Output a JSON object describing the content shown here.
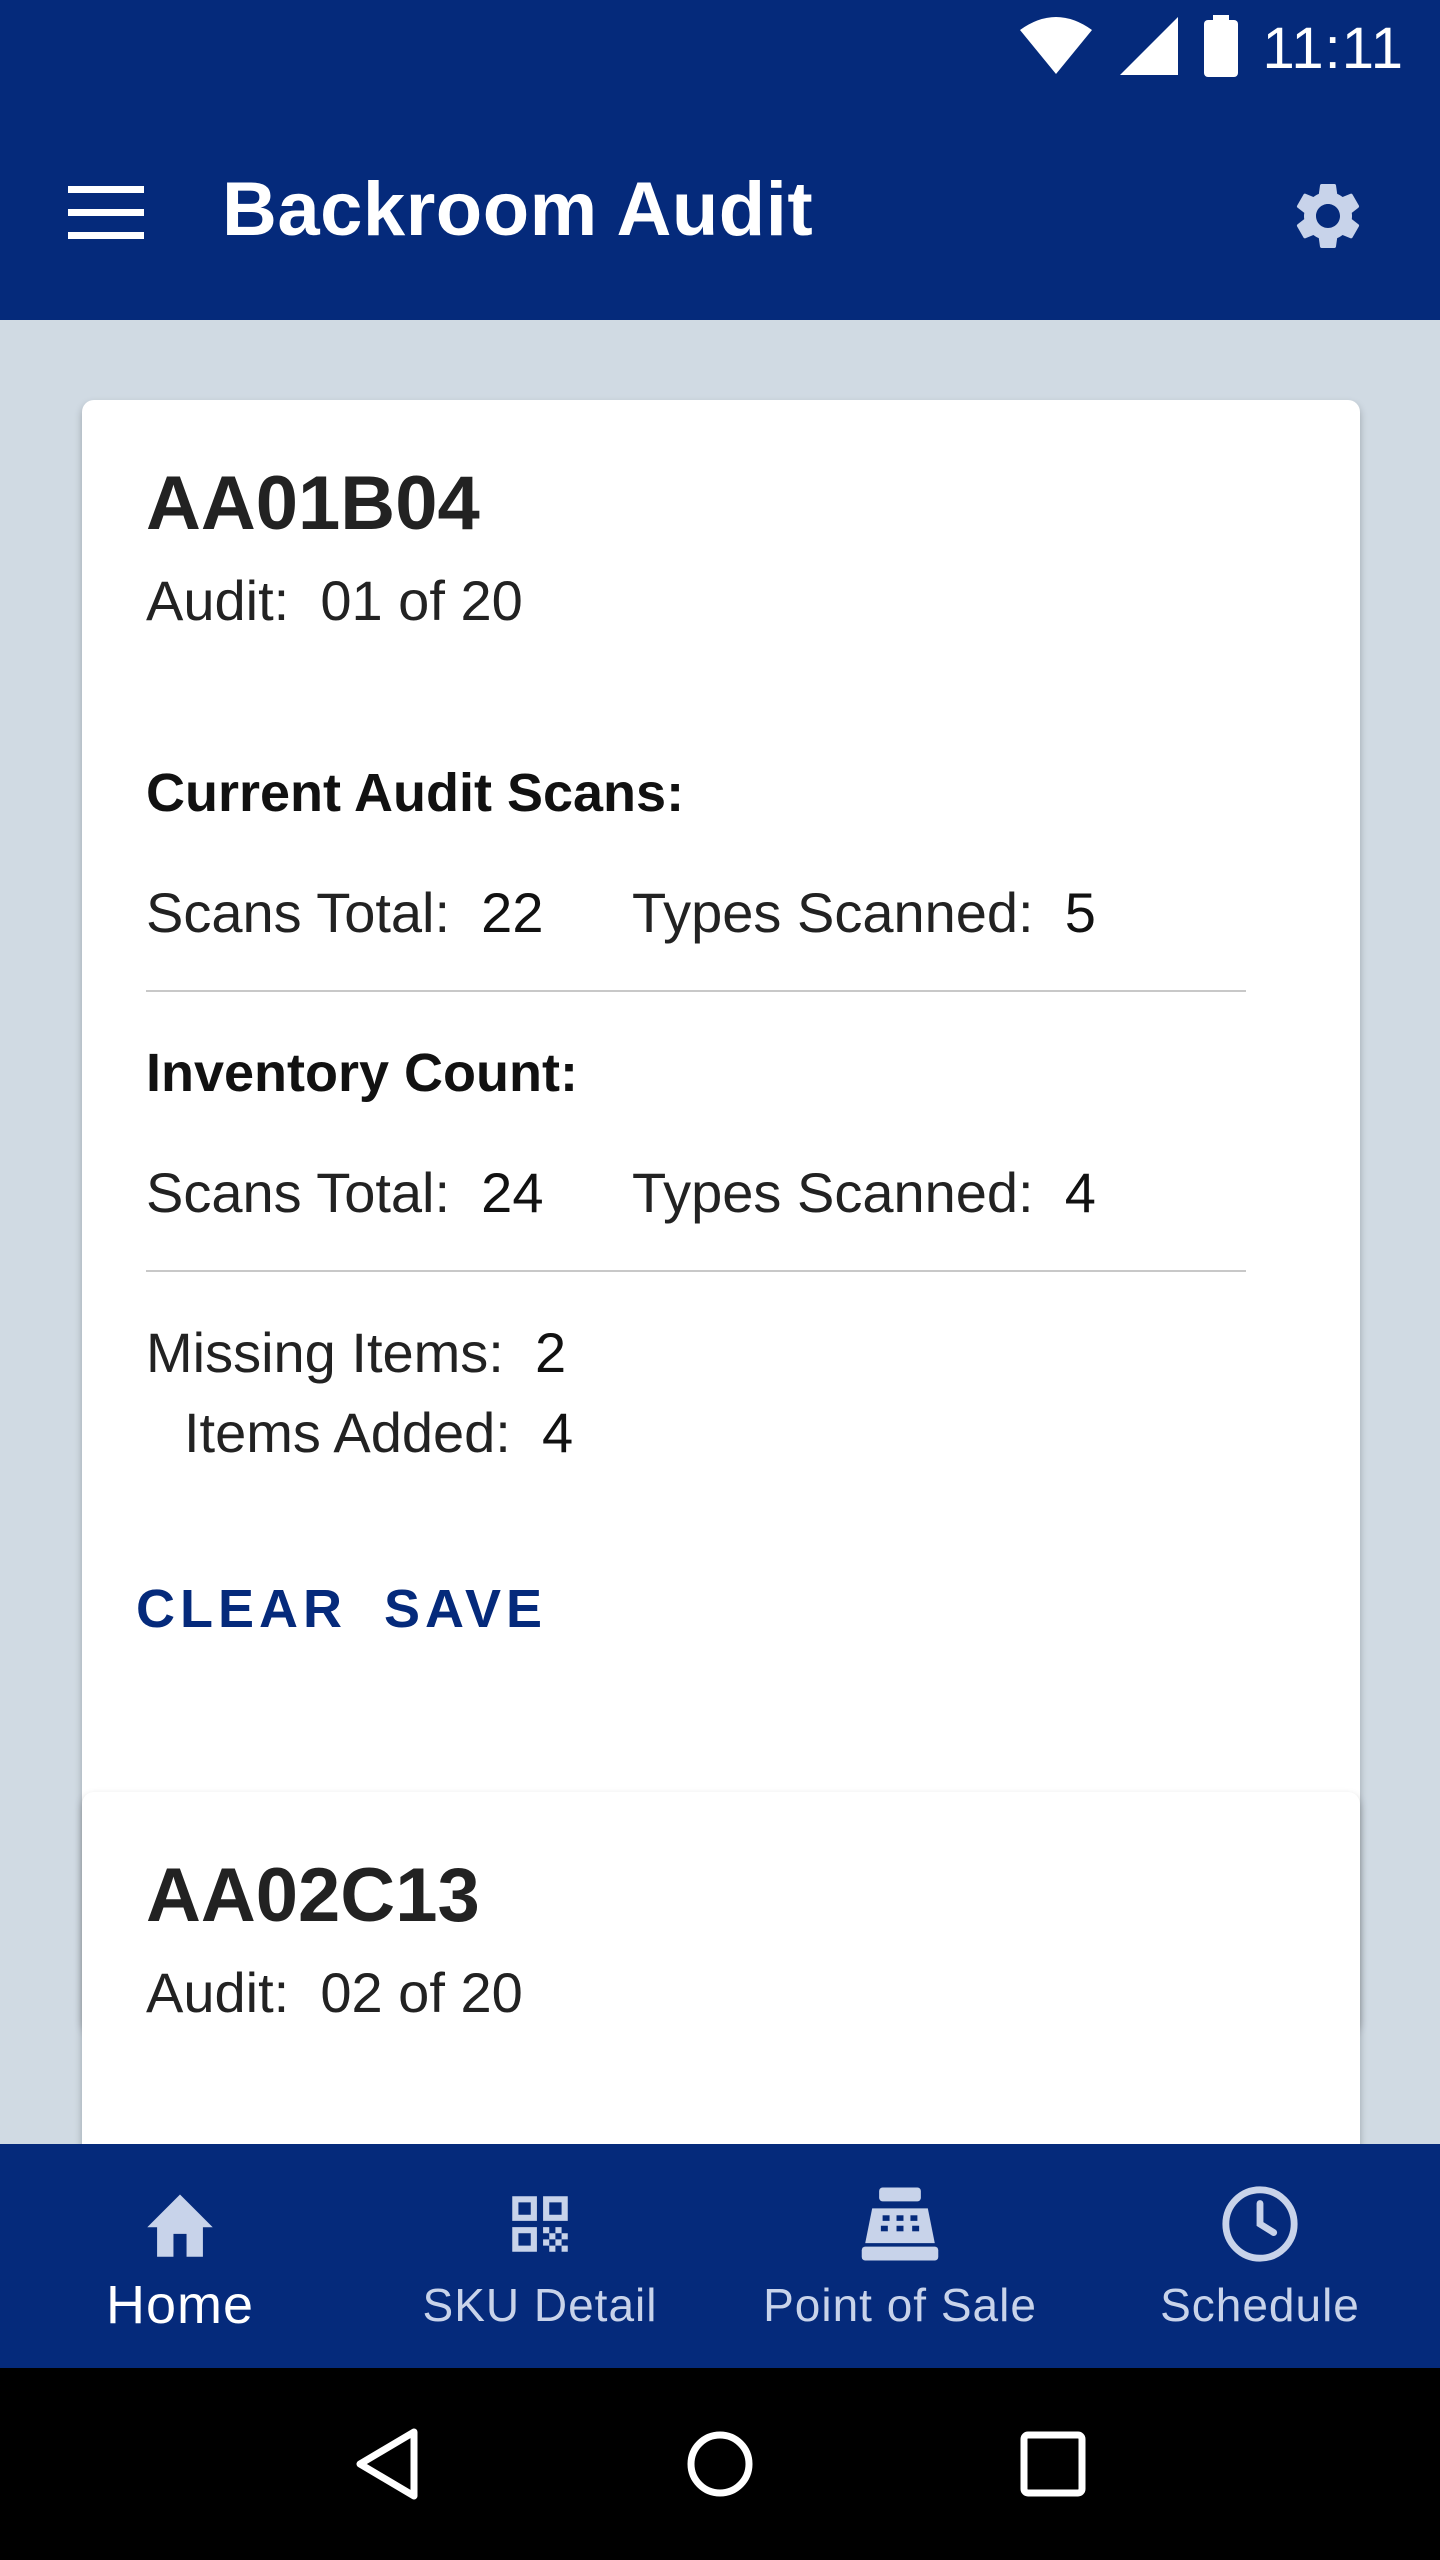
{
  "status_bar": {
    "time": "11:11",
    "icons": [
      "wifi-icon",
      "signal-icon",
      "battery-icon"
    ]
  },
  "app_bar": {
    "title": "Backroom Audit",
    "menu_icon": "hamburger-menu-icon",
    "settings_icon": "gear-icon"
  },
  "cards": [
    {
      "id": "AA01B04",
      "audit_label": "Audit:",
      "audit_value": "01 of 20",
      "current_scans": {
        "title": "Current Audit Scans:",
        "scans_total_label": "Scans Total:",
        "scans_total_value": "22",
        "types_scanned_label": "Types Scanned:",
        "types_scanned_value": "5"
      },
      "inventory_count": {
        "title": "Inventory Count:",
        "scans_total_label": "Scans Total:",
        "scans_total_value": "24",
        "types_scanned_label": "Types Scanned:",
        "types_scanned_value": "4"
      },
      "missing_items_label": "Missing Items:",
      "missing_items_value": "2",
      "items_added_label": "Items Added:",
      "items_added_value": "4",
      "clear_label": "CLEAR",
      "save_label": "SAVE"
    },
    {
      "id": "AA02C13",
      "audit_label": "Audit:",
      "audit_value": "02 of 20"
    }
  ],
  "bottom_nav": [
    {
      "label": "Home",
      "icon": "home-icon",
      "active": true
    },
    {
      "label": "SKU Detail",
      "icon": "qr-code-icon",
      "active": false
    },
    {
      "label": "Point of Sale",
      "icon": "cash-register-icon",
      "active": false
    },
    {
      "label": "Schedule",
      "icon": "clock-icon",
      "active": false
    }
  ],
  "system_nav": [
    "back-icon",
    "home-circle-icon",
    "recents-icon"
  ],
  "colors": {
    "primary": "#052a7b",
    "background": "#d0dae3",
    "card": "#ffffff"
  }
}
